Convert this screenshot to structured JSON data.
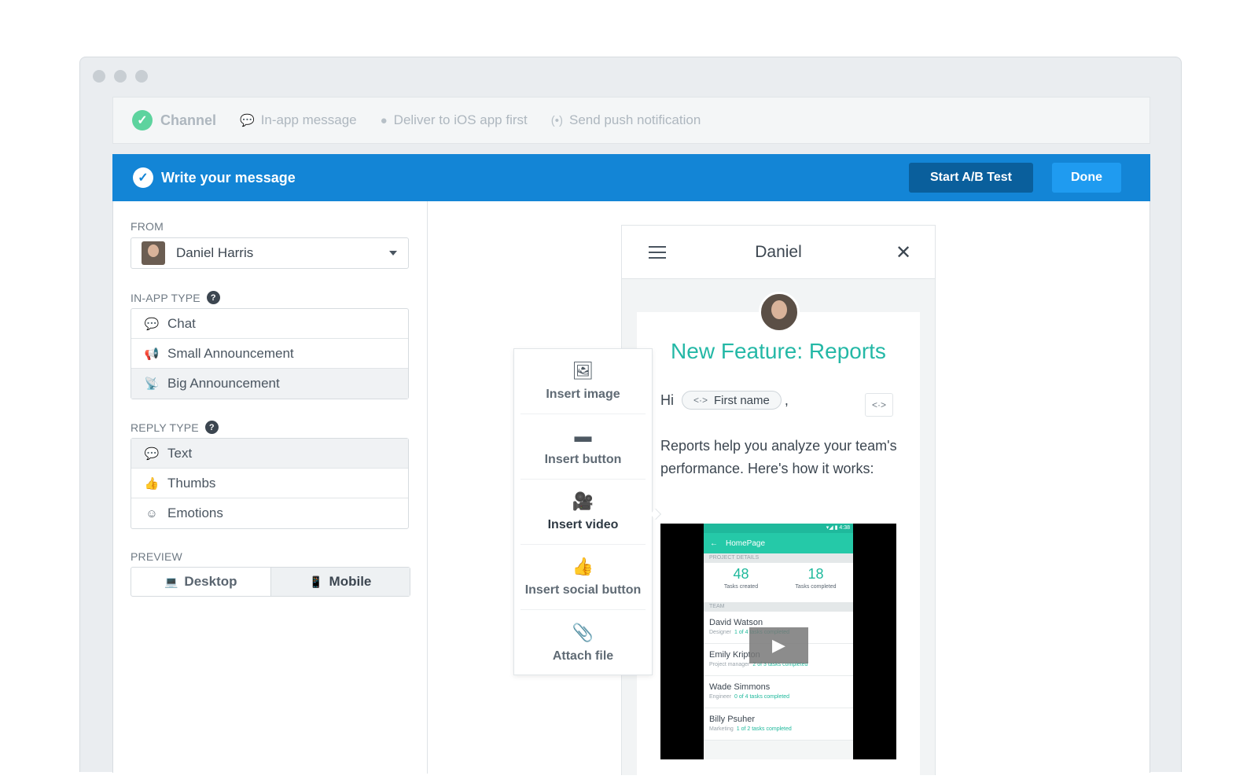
{
  "steps": [
    {
      "label": "Channel",
      "icon": "check-circle-icon"
    },
    {
      "label": "In-app message",
      "icon": "chat-bubble-icon"
    },
    {
      "label": "Deliver to iOS app first",
      "icon": "apple-icon"
    },
    {
      "label": "Send push notification",
      "icon": "broadcast-icon"
    }
  ],
  "header": {
    "title": "Write your message",
    "ab_test_label": "Start A/B Test",
    "done_label": "Done"
  },
  "from": {
    "label": "FROM",
    "value": "Daniel Harris"
  },
  "in_app_type": {
    "label": "IN-APP TYPE",
    "options": [
      "Chat",
      "Small Announcement",
      "Big Announcement"
    ],
    "selected": "Big Announcement"
  },
  "reply_type": {
    "label": "REPLY TYPE",
    "options": [
      "Text",
      "Thumbs",
      "Emotions"
    ],
    "selected": "Text"
  },
  "preview": {
    "label": "PREVIEW",
    "desktop": "Desktop",
    "mobile": "Mobile",
    "selected": "Mobile"
  },
  "insert_menu": [
    "Insert image",
    "Insert button",
    "Insert video",
    "Insert social button",
    "Attach file"
  ],
  "phone": {
    "name": "Daniel",
    "title": "New Feature: Reports",
    "greeting": "Hi",
    "first_name_tag": "First name",
    "comma": ",",
    "body": "Reports help you analyze your team's performance. Here's how it works:"
  },
  "video_app": {
    "status": "▾◢ ▮ 4:38",
    "bar_title": "HomePage",
    "section_project": "PROJECT DETAILS",
    "stats": [
      {
        "n": "48",
        "l": "Tasks created"
      },
      {
        "n": "18",
        "l": "Tasks completed"
      }
    ],
    "section_team": "TEAM",
    "members": [
      {
        "name": "David Watson",
        "role": "Designer",
        "progress": "1 of 4 tasks completed"
      },
      {
        "name": "Emily Kripton",
        "role": "Project manager",
        "progress": "2 of 3 tasks completed"
      },
      {
        "name": "Wade Simmons",
        "role": "Engineer",
        "progress": "0 of 4 tasks completed"
      },
      {
        "name": "Billy Psuher",
        "role": "Marketing",
        "progress": "1 of 2 tasks completed"
      }
    ]
  },
  "colors": {
    "primary": "#1385d6",
    "dark_button": "#0a5f9c",
    "teal": "#24b8a6",
    "success": "#5dd39e"
  }
}
